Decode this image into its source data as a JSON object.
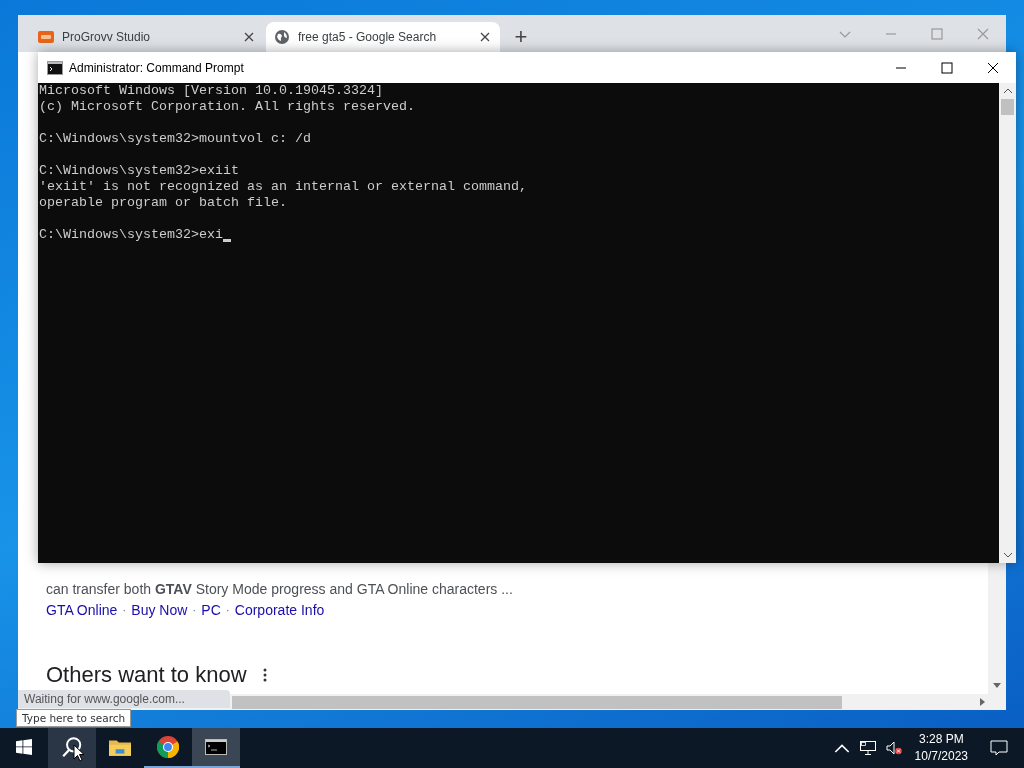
{
  "browser": {
    "tabs": [
      {
        "title": "ProGrovv Studio",
        "selected": false,
        "kind": "site"
      },
      {
        "title": "free gta5 - Google Search",
        "selected": true,
        "kind": "globe"
      }
    ],
    "new_tab": "+",
    "snippet": "can transfer both **GTAV** Story Mode progress and GTA Online characters ...",
    "links": [
      "GTA Online",
      "Buy Now",
      "PC",
      "Corporate Info"
    ],
    "link_separator": "·",
    "section_heading": "Others want to know",
    "status_text": "Waiting for www.google.com..."
  },
  "cmd": {
    "title": "Administrator: Command Prompt",
    "blocks": [
      [
        "Microsoft Windows [Version 10.0.19045.3324]",
        "(c) Microsoft Corporation. All rights reserved."
      ],
      [
        "C:\\Windows\\system32>mountvol c: /d"
      ],
      [
        "C:\\Windows\\system32>exiit",
        "'exiit' is not recognized as an internal or external command,",
        "operable program or batch file."
      ]
    ],
    "input": "C:\\Windows\\system32>exi"
  },
  "tooltip": "Type here to search",
  "taskbar": {
    "apps": [
      {
        "kind": "search",
        "running": false,
        "active": false,
        "hovered": true
      },
      {
        "kind": "files",
        "running": false,
        "active": false,
        "hovered": false
      },
      {
        "kind": "browser",
        "running": true,
        "active": false,
        "hovered": false
      },
      {
        "kind": "terminal",
        "running": true,
        "active": true,
        "hovered": false
      }
    ],
    "volume_muted": true,
    "time": "3:28 PM",
    "date": "10/7/2023"
  }
}
